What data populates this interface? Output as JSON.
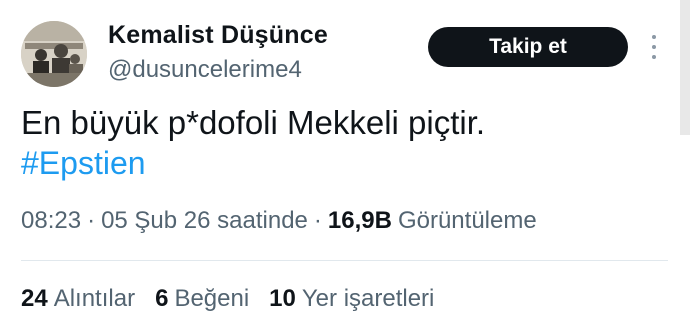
{
  "account": {
    "display_name": "Kemalist Düşünce",
    "handle": "@dusuncelerime4"
  },
  "actions": {
    "follow_label": "Takip et",
    "more_icon": "more-vertical-icon"
  },
  "tweet": {
    "text": "En büyük p*dofoli Mekkeli piçtir.",
    "hashtag": "#Epstien"
  },
  "meta": {
    "time": "08:23",
    "separator": "·",
    "date": "05 Şub 26 saatinde",
    "views_count": "16,9B",
    "views_label": "Görüntüleme"
  },
  "stats": [
    {
      "count": "24",
      "label": "Alıntılar"
    },
    {
      "count": "6",
      "label": "Beğeni"
    },
    {
      "count": "10",
      "label": "Yer işaretleri"
    }
  ],
  "colors": {
    "link": "#1d9bf0",
    "secondary_text": "#536471",
    "button_bg": "#0f1419"
  }
}
